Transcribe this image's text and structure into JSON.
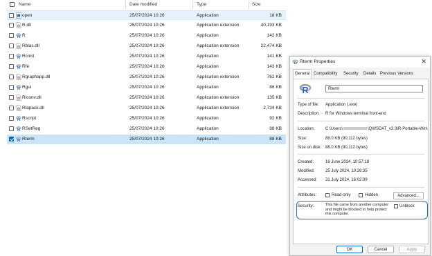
{
  "explorer": {
    "columns": {
      "name": "Name",
      "date": "Date modified",
      "type": "Type",
      "size": "Size"
    },
    "rows": [
      {
        "name": "open",
        "date": "25/07/2024 10:26",
        "type": "Application",
        "size": "18 KB",
        "icon": "app-doc-icon",
        "state": "highlight",
        "checked": false
      },
      {
        "name": "R.dll",
        "date": "25/07/2024 10:26",
        "type": "Application extension",
        "size": "40,193 KB",
        "icon": "dll-icon",
        "state": "",
        "checked": false
      },
      {
        "name": "R",
        "date": "25/07/2024 10:26",
        "type": "Application",
        "size": "142 KB",
        "icon": "r-app-icon",
        "state": "",
        "checked": false
      },
      {
        "name": "Rblas.dll",
        "date": "25/07/2024 10:26",
        "type": "Application extension",
        "size": "22,474 KB",
        "icon": "dll-icon",
        "state": "",
        "checked": false
      },
      {
        "name": "Rcmd",
        "date": "25/07/2024 10:26",
        "type": "Application",
        "size": "141 KB",
        "icon": "r-app-icon",
        "state": "",
        "checked": false
      },
      {
        "name": "Rfe",
        "date": "25/07/2024 10:26",
        "type": "Application",
        "size": "143 KB",
        "icon": "r-app-icon",
        "state": "",
        "checked": false
      },
      {
        "name": "Rgraphapp.dll",
        "date": "25/07/2024 10:26",
        "type": "Application extension",
        "size": "762 KB",
        "icon": "dll-icon",
        "state": "",
        "checked": false
      },
      {
        "name": "Rgui",
        "date": "25/07/2024 10:26",
        "type": "Application",
        "size": "86 KB",
        "icon": "r-app-icon",
        "state": "",
        "checked": false
      },
      {
        "name": "Riconv.dll",
        "date": "25/07/2024 10:26",
        "type": "Application extension",
        "size": "135 KB",
        "icon": "dll-icon",
        "state": "",
        "checked": false
      },
      {
        "name": "Rlapack.dll",
        "date": "25/07/2024 10:26",
        "type": "Application extension",
        "size": "2,734 KB",
        "icon": "dll-icon",
        "state": "",
        "checked": false
      },
      {
        "name": "Rscript",
        "date": "25/07/2024 10:26",
        "type": "Application",
        "size": "92 KB",
        "icon": "r-app-icon",
        "state": "",
        "checked": false
      },
      {
        "name": "RSetReg",
        "date": "25/07/2024 10:26",
        "type": "Application",
        "size": "88 KB",
        "icon": "r-app-icon",
        "state": "",
        "checked": false
      },
      {
        "name": "Rterm",
        "date": "25/07/2024 10:26",
        "type": "Application",
        "size": "88 KB",
        "icon": "r-app-icon",
        "state": "selected",
        "checked": true
      }
    ]
  },
  "dialog": {
    "title": "Rterm Properties",
    "close": "✕",
    "tabs": [
      "General",
      "Compatibility",
      "Security",
      "Details",
      "Previous Versions"
    ],
    "active_tab": "General",
    "file_name": "Rterm",
    "type_label": "Type of file:",
    "type_value": "Application (.exe)",
    "desc_label": "Description:",
    "desc_value": "R for Windows terminal front-end",
    "location_label": "Location:",
    "location_value_start": "C:\\Users\\",
    "location_value_end": "\\QWSDAT_v3.3\\R-Portable-Win\\",
    "size_label": "Size:",
    "size_value": "88.0 KB (90,112 bytes)",
    "disk_label": "Size on disk:",
    "disk_value": "88.0 KB (90,112 bytes)",
    "created_label": "Created:",
    "created_value": "16 June 2024, 10:57:18",
    "modified_label": "Modified:",
    "modified_value": "25 July 2024, 10:26:35",
    "accessed_label": "Accessed:",
    "accessed_value": "31 July 2024, 16:02:09",
    "attributes_label": "Attributes:",
    "readonly_label": "Read-only",
    "hidden_label": "Hidden",
    "advanced_label": "Advanced...",
    "security_label": "Security:",
    "security_note": "This file came from another computer and might be blocked to help protect this computer.",
    "unblock_label": "Unblock",
    "ok_label": "OK",
    "cancel_label": "Cancel",
    "apply_label": "Apply"
  },
  "colors": {
    "accent": "#0067c0",
    "selection": "#cce4f7",
    "hover": "#e5f3ff",
    "annotation": "#1e6fc8",
    "r_blue": "#2166c6",
    "r_grey": "#9ea3a8"
  }
}
